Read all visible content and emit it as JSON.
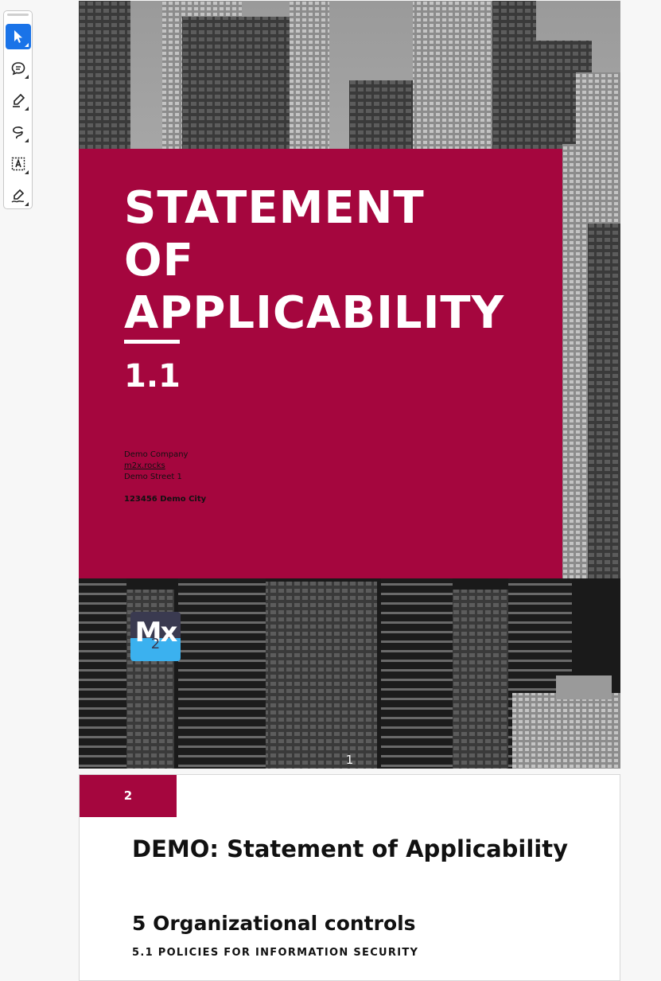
{
  "toolbar": {
    "tools": [
      {
        "name": "select-tool",
        "icon": "cursor-arrow-icon",
        "active": true
      },
      {
        "name": "comment-tool",
        "icon": "comment-icon",
        "active": false
      },
      {
        "name": "highlight-tool",
        "icon": "highlighter-icon",
        "active": false
      },
      {
        "name": "freehand-tool",
        "icon": "lasso-draw-icon",
        "active": false
      },
      {
        "name": "text-box-tool",
        "icon": "text-box-icon",
        "active": false
      },
      {
        "name": "signature-tool",
        "icon": "signature-pen-icon",
        "active": false
      }
    ]
  },
  "cover": {
    "title_lines": [
      "STATEMENT",
      "OF",
      "APPLICABILITY"
    ],
    "version": "1.1",
    "company": "Demo Company",
    "website": "m2x.rocks",
    "street": "Demo Street 1",
    "city": "123456 Demo City",
    "logo_text": "Mx",
    "logo_sub": "2",
    "page_number": "1"
  },
  "page2": {
    "tab_number": "2",
    "heading": "DEMO: Statement of Applicability",
    "section": "5 Organizational controls",
    "subsection": "5.1 POLICIES FOR INFORMATION SECURITY"
  },
  "colors": {
    "brand": "#a5063e",
    "toolbar_active": "#1a73e8",
    "logo_dark": "#3a3a50",
    "logo_blue": "#3bb1ef"
  }
}
